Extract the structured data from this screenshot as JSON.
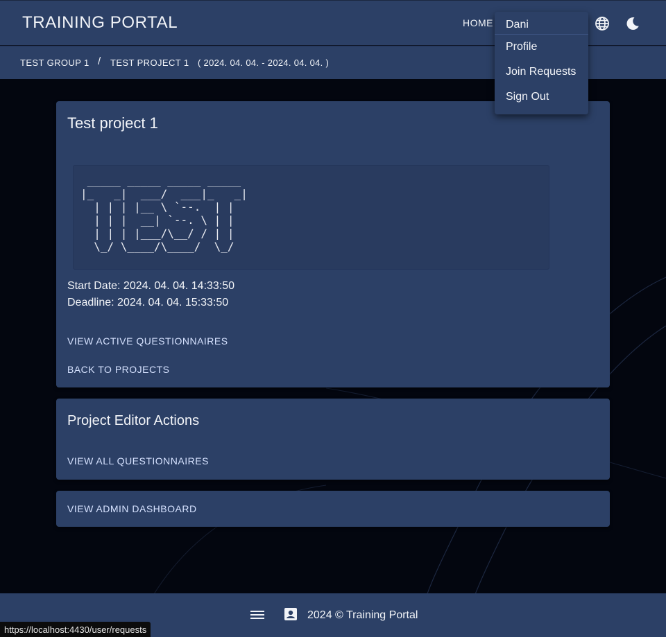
{
  "header": {
    "title": "TRAINING PORTAL",
    "nav_home": "HOME",
    "icons": [
      "globe-icon",
      "moon-icon"
    ]
  },
  "breadcrumb": {
    "group": "TEST GROUP 1",
    "separator": "/",
    "project": "TEST PROJECT 1",
    "dates": "( 2024. 04. 04. - 2024. 04. 04. )"
  },
  "user_menu": {
    "username": "Dani",
    "items": [
      "Profile",
      "Join Requests",
      "Sign Out"
    ]
  },
  "project_card": {
    "title": "Test project 1",
    "ascii_art": " _____ _____ _____ _____\n|_   _|  ___/  ___|_   _|\n  | | | |__ \\ `--.  | |\n  | | |  __| `--. \\ | |\n  | | | |___/\\__/ / | |\n  \\_/ \\____/\\____/  \\_/",
    "start_date": "Start Date: 2024. 04. 04. 14:33:50",
    "deadline": "Deadline: 2024. 04. 04. 15:33:50",
    "view_active_label": "VIEW ACTIVE QUESTIONNAIRES",
    "back_label": "BACK TO PROJECTS"
  },
  "editor_card": {
    "title": "Project Editor Actions",
    "view_all_label": "VIEW ALL QUESTIONNAIRES"
  },
  "admin_card": {
    "label": "VIEW ADMIN DASHBOARD"
  },
  "footer": {
    "text": "2024 © Training Portal",
    "icons": [
      "menu-icon",
      "contact-card-icon"
    ]
  },
  "status_bar": {
    "url": "https://localhost:4430/user/requests"
  },
  "colors": {
    "bar": "#2c4066",
    "background": "#03060f",
    "link": "#d6e2ff"
  }
}
